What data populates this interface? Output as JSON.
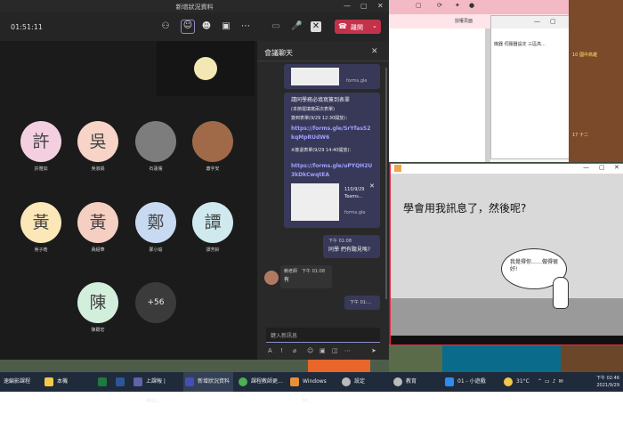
{
  "teams": {
    "window_title": "新增狀況資料",
    "timer": "01:51:11",
    "leave_label": "離開",
    "participants": [
      {
        "char": "許",
        "name": "許雅如",
        "bg": "#f4cfe0"
      },
      {
        "char": "吳",
        "name": "吳淑娟",
        "bg": "#f7d3c8"
      },
      {
        "char": "",
        "name": "石蓮儒",
        "bg": "#7d7d7d"
      },
      {
        "char": "",
        "name": "蕭宇安",
        "bg": "#a06a48"
      },
      {
        "char": "黃",
        "name": "吳子皓",
        "bg": "#fbe7b8"
      },
      {
        "char": "黃",
        "name": "黃紹華",
        "bg": "#f5cfc2"
      },
      {
        "char": "鄭",
        "name": "鄭小瑜",
        "bg": "#c8daf1"
      },
      {
        "char": "譚",
        "name": "譚芳鈴",
        "bg": "#cfe9ee"
      },
      {
        "char": "陳",
        "name": "陳聰宏",
        "bg": "#d2efdc"
      },
      {
        "char": "+56",
        "name": "",
        "bg": "#3b3b3b"
      }
    ]
  },
  "chat": {
    "header": "會議聊天",
    "msg1": {
      "line1": "請同學務必填寫簽到表單",
      "line2": "(本節需填寫兩次表單)",
      "line3": "簽到表單(9/29 12:30開放)：",
      "link1": "https://forms.gle/SrYfasS2kqMpRUdW6",
      "line4": "※簽退表單(9/29 14:40開放)：",
      "link2": "https://forms.gle/uPYQH2U3kDkCwqtEA",
      "card_date": "110/9/29",
      "card_name": "Teams...",
      "card_source": "forms.gle"
    },
    "top_card_source": "forms.gle",
    "msg2": {
      "time": "下午 01:08",
      "text": "同學 們有聽見嗎?"
    },
    "msg3": {
      "sender": "賴老師",
      "time": "下午 01:08",
      "text": "有"
    },
    "msg4": {
      "time": "下午 01:..."
    },
    "compose_placeholder": "鍵入新訊息"
  },
  "browser": {
    "tab_label": "授權頁面",
    "dialog_text": "機器 伺服器設定 三區高..."
  },
  "calendar": {
    "cell1": "10 國中高雄",
    "cell2": "17 十二"
  },
  "player": {
    "slide_text": "學會用我訊息了，然後呢?",
    "speech_text": "我覺得你……做得很好!"
  },
  "taskbar": {
    "items": [
      {
        "label": "速編影課程",
        "color": "#ffffff"
      },
      {
        "label": "本機",
        "color": "#f2c94c"
      },
      {
        "label": "",
        "color": "#1e7a3e"
      },
      {
        "label": "",
        "color": "#2b579a"
      },
      {
        "label": "上課報 | Micr...",
        "color": "#6264a7"
      },
      {
        "label": "新增狀況資料",
        "color": "#464eb8"
      },
      {
        "label": "課程教師更...",
        "color": "#4caf50"
      },
      {
        "label": "Windows M...",
        "color": "#e88f3a"
      },
      {
        "label": "設定",
        "color": "#bbbbbb"
      },
      {
        "label": "教育",
        "color": "#bbbbbb"
      },
      {
        "label": "01 - 小遊戲",
        "color": "#2d8cf0"
      }
    ],
    "weather": "31°C",
    "time": "下午 02:46",
    "date": "2021/9/29"
  }
}
